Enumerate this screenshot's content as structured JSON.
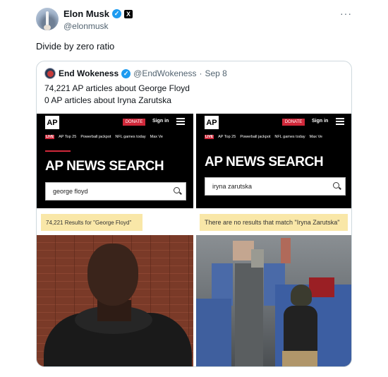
{
  "author": {
    "name": "Elon Musk",
    "handle": "@elonmusk",
    "verified_icon": "verified-badge-icon",
    "affiliate_icon": "x-logo-icon"
  },
  "more_label": "···",
  "tweet_text": "Divide by zero ratio",
  "quote": {
    "name": "End Wokeness",
    "handle": "@EndWokeness",
    "separator": "·",
    "date": "Sep 8",
    "line1": "74,221 AP articles about George Floyd",
    "line2": "0 AP articles about Iryna Zarutska",
    "left_panel": {
      "logo": "AP",
      "donate": "DONATE",
      "signin": "Sign in",
      "nav": [
        "LIVE",
        "AP Top 25",
        "Powerball jackpot",
        "NFL games today",
        "Max Ve"
      ],
      "title": "AP NEWS SEARCH",
      "query": "george floyd",
      "result": "74,221 Results for \"George Floyd\""
    },
    "right_panel": {
      "logo": "AP",
      "donate": "DONATE",
      "signin": "Sign in",
      "nav": [
        "LIVE",
        "AP Top 25",
        "Powerball jackpot",
        "NFL games today",
        "Max Ve"
      ],
      "title": "AP NEWS SEARCH",
      "query": "iryna zarutska",
      "result": "There are no results that match \"Iryna Zarutska\""
    }
  },
  "colors": {
    "verified": "#1d9bf0",
    "ap_red": "#d0283a",
    "highlight": "#f9e7a8"
  }
}
